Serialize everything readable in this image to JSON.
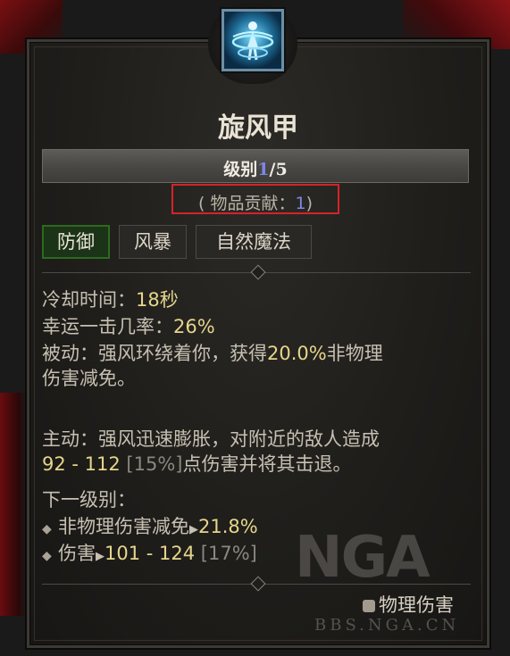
{
  "skill": {
    "name": "旋风甲",
    "rank_label": "级别",
    "rank_current": "1",
    "rank_max": "/5",
    "contribution_open": "( 物品贡献：",
    "contribution_value": "1",
    "contribution_close": ")"
  },
  "tags": [
    "防御",
    "风暴",
    "自然魔法"
  ],
  "stats": {
    "cooldown_label": "冷却时间：",
    "cooldown_value": "18秒",
    "lucky_label": "幸运一击几率：",
    "lucky_value": "26%",
    "passive_pre": "被动：强风环绕着你，获得",
    "passive_value": "20.0%",
    "passive_post": "非物理",
    "passive_line2": "伤害减免。",
    "active_line1": "主动：强风迅速膨胀，对附近的敌人造成",
    "active_damage": "92 - 112",
    "active_pct": "[15%]",
    "active_post": "点伤害并将其击退。"
  },
  "next_rank": {
    "header": "下一级别：",
    "item1_label": "非物理伤害减免",
    "item1_value": "21.8%",
    "item2_label": "伤害",
    "item2_value": "101 - 124",
    "item2_pct": "[17%]"
  },
  "damage_type": "物理伤害",
  "watermark": {
    "logo": "NGA",
    "site": "BBS.NGA.CN"
  },
  "colors": {
    "highlight": "#e6d58c",
    "rank_blue": "#7d86e6",
    "annotation_red": "#d5232a",
    "active_tag_green": "#2d6a1f",
    "icon_blue": "#0b2b44"
  },
  "icons": {
    "skill_icon": "cyclone-armor-icon",
    "damage_type_icon": "physical-damage-icon"
  }
}
